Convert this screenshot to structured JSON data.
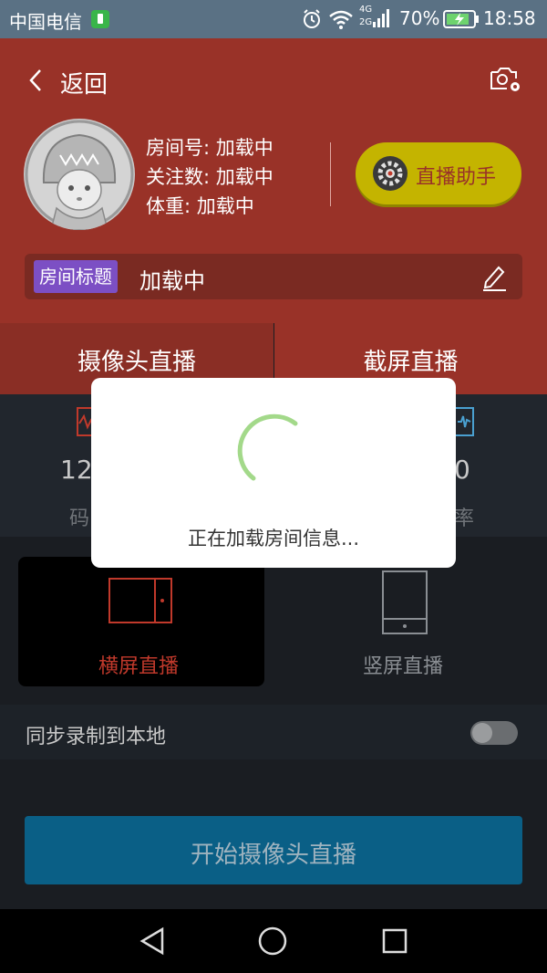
{
  "status_bar": {
    "carrier": "中国电信",
    "network_top": "4G",
    "network_bottom": "2G",
    "battery_percent": "70%",
    "time": "18:58"
  },
  "header": {
    "back_label": "返回",
    "room_id": "房间号: 加载中",
    "followers": "关注数: 加载中",
    "weight": "体重: 加载中",
    "assistant_button": "直播助手",
    "room_title_tag": "房间标题",
    "room_title_value": "加载中"
  },
  "tabs": [
    {
      "label": "摄像头直播",
      "selected": true
    },
    {
      "label": "截屏直播",
      "selected": false
    }
  ],
  "stats": {
    "left_value": "12",
    "left_label": "码",
    "right_value": "0",
    "right_label": "率"
  },
  "orientation": {
    "landscape_label": "横屏直播",
    "portrait_label": "竖屏直播",
    "selected": "landscape"
  },
  "record_local": {
    "label": "同步录制到本地",
    "enabled": false
  },
  "start_button": "开始摄像头直播",
  "dialog": {
    "message": "正在加载房间信息..."
  },
  "colors": {
    "header_red": "#993228",
    "accent_yellow": "#c4b400",
    "tag_purple": "#7c4fc4",
    "start_blue": "#0a5f86",
    "spinner_green": "#a3d98a"
  }
}
